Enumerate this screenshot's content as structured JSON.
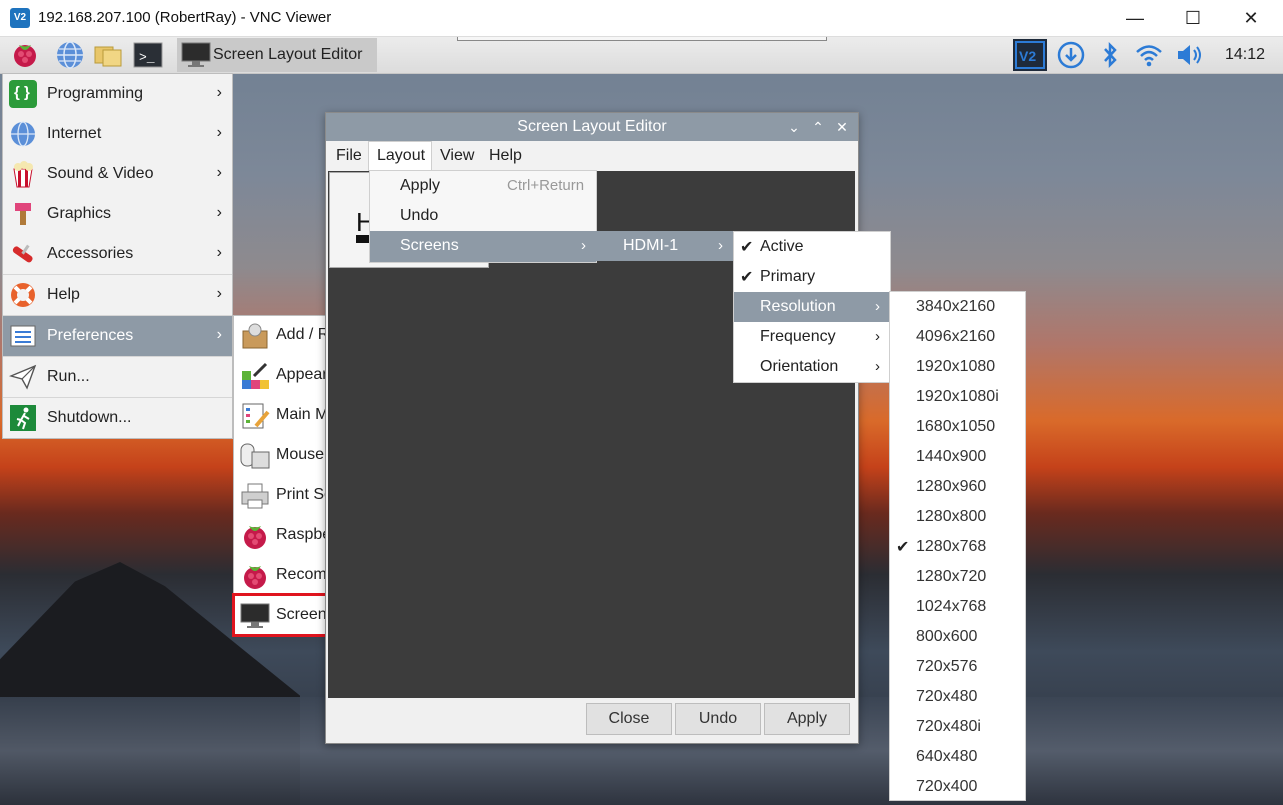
{
  "vnc": {
    "title": "192.168.207.100 (RobertRay) - VNC Viewer",
    "logo": "V2",
    "minimize": "—",
    "maximize": "☐",
    "close": "✕"
  },
  "taskbar": {
    "task_label": "Screen Layout Editor",
    "clock": "14:12",
    "icons": [
      "raspberry-icon",
      "globe-icon",
      "folder-icon",
      "terminal-icon"
    ],
    "tray_icons": [
      "vnc-icon",
      "download-icon",
      "bluetooth-icon",
      "wifi-icon",
      "volume-icon"
    ]
  },
  "main_menu": {
    "items": [
      {
        "label": "Programming",
        "icon": "programming-icon",
        "arrow": "›"
      },
      {
        "label": "Internet",
        "icon": "globe-icon",
        "arrow": "›"
      },
      {
        "label": "Sound & Video",
        "icon": "popcorn-icon",
        "arrow": "›"
      },
      {
        "label": "Graphics",
        "icon": "paintbrush-icon",
        "arrow": "›"
      },
      {
        "label": "Accessories",
        "icon": "swiss-knife-icon",
        "arrow": "›"
      },
      {
        "label": "Help",
        "icon": "lifebuoy-icon",
        "arrow": "›"
      },
      {
        "label": "Preferences",
        "icon": "preferences-icon",
        "arrow": "›"
      },
      {
        "label": "Run...",
        "icon": "paper-plane-icon"
      },
      {
        "label": "Shutdown...",
        "icon": "exit-icon"
      }
    ]
  },
  "preferences_menu": {
    "items": [
      {
        "label": "Add / Remove Software",
        "icon": "package-icon"
      },
      {
        "label": "Appearance Settings",
        "icon": "palette-icon"
      },
      {
        "label": "Main Menu Editor",
        "icon": "menu-editor-icon"
      },
      {
        "label": "Mouse and Keyboard Settings",
        "icon": "mouse-keyboard-icon"
      },
      {
        "label": "Print Settings",
        "icon": "printer-icon"
      },
      {
        "label": "Raspberry Pi Configuration",
        "icon": "raspberry-icon"
      },
      {
        "label": "Recommended Software",
        "icon": "raspberry-icon"
      },
      {
        "label": "Screen Configuration",
        "icon": "monitor-icon"
      }
    ]
  },
  "screen_layout_editor": {
    "title": "Screen Layout Editor",
    "controls": {
      "collapse": "⌄",
      "expand": "⌃",
      "close": "✕"
    },
    "menubar": [
      "File",
      "Layout",
      "View",
      "Help"
    ],
    "monitor_label": "H",
    "buttons": {
      "close": "Close",
      "undo": "Undo",
      "apply": "Apply"
    }
  },
  "layout_menu": {
    "items": [
      {
        "label": "Apply",
        "accel": "Ctrl+Return"
      },
      {
        "label": "Undo",
        "accel": ""
      },
      {
        "label": "Screens",
        "accel": "",
        "arrow": "›"
      }
    ]
  },
  "screens_submenu": {
    "label": "HDMI-1",
    "arrow": "›"
  },
  "hdmi_submenu": {
    "items": [
      {
        "label": "Active",
        "check": "✔"
      },
      {
        "label": "Primary",
        "check": "✔"
      },
      {
        "label": "Resolution",
        "check": "",
        "arrow": "›"
      },
      {
        "label": "Frequency",
        "check": "",
        "arrow": "›"
      },
      {
        "label": "Orientation",
        "check": "",
        "arrow": "›"
      }
    ]
  },
  "resolution_submenu": {
    "items": [
      {
        "label": "3840x2160",
        "check": ""
      },
      {
        "label": "4096x2160",
        "check": ""
      },
      {
        "label": "1920x1080",
        "check": ""
      },
      {
        "label": "1920x1080i",
        "check": ""
      },
      {
        "label": "1680x1050",
        "check": ""
      },
      {
        "label": "1440x900",
        "check": ""
      },
      {
        "label": "1280x960",
        "check": ""
      },
      {
        "label": "1280x800",
        "check": ""
      },
      {
        "label": "1280x768",
        "check": "✔"
      },
      {
        "label": "1280x720",
        "check": ""
      },
      {
        "label": "1024x768",
        "check": ""
      },
      {
        "label": "800x600",
        "check": ""
      },
      {
        "label": "720x576",
        "check": ""
      },
      {
        "label": "720x480",
        "check": ""
      },
      {
        "label": "720x480i",
        "check": ""
      },
      {
        "label": "640x480",
        "check": ""
      },
      {
        "label": "720x400",
        "check": ""
      }
    ]
  },
  "colors": {
    "menu_highlight": "#8e9aa6",
    "callout_border": "#e0141e",
    "vnc_blue": "#1e73be"
  }
}
